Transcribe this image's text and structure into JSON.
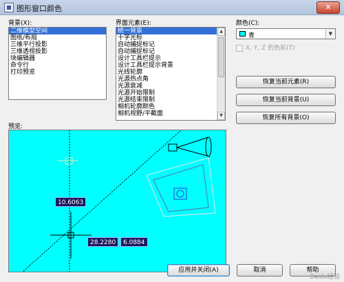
{
  "window": {
    "title": "图形窗口颜色",
    "close_label": "✕"
  },
  "context": {
    "label": "背景(X):",
    "items": [
      "二维模型空间",
      "图纸/布局",
      "三维平行投影",
      "三维透视投影",
      "块编辑器",
      "命令行",
      "打印预览"
    ],
    "selected_index": 0
  },
  "interface_element": {
    "label": "界面元素(E):",
    "items": [
      "统一背景",
      "十字光标",
      "自动捕捉标记",
      "自动捕捉标记",
      "设计工具栏提示",
      "设计工具栏提示背景",
      "光线轮廓",
      "光源热点角",
      "光源衰减",
      "光源开始限制",
      "光源结束限制",
      "相机轮廓颜色",
      "相机视野/平截面"
    ],
    "selected_index": 0
  },
  "color": {
    "label": "颜色(C):",
    "value": "青",
    "swatch_color": "#00ffff"
  },
  "tint_checkbox": {
    "label": "X, Y, Z 的色彩(T)",
    "checked": false,
    "enabled": false
  },
  "buttons": {
    "restore_element": "恢复当前元素(R)",
    "restore_context": "恢复当前背景(U)",
    "restore_all": "恢复所有背景(O)",
    "apply_close": "应用并关闭(A)",
    "cancel": "取消",
    "help": "帮助"
  },
  "preview": {
    "label": "预览:",
    "background_color": "#00ffff",
    "coords": [
      "10.6063",
      "28.2280",
      "6.0884"
    ]
  },
  "watermark": "Baidu经验"
}
